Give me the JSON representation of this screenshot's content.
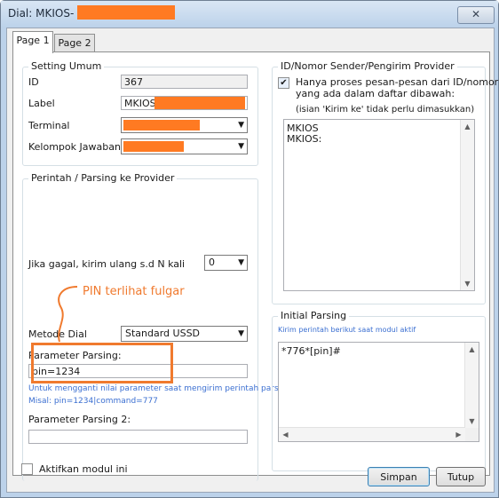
{
  "window": {
    "title": "Dial: MKIOS-",
    "close_glyph": "✕"
  },
  "tabs": [
    {
      "label": "Page 1",
      "active": true
    },
    {
      "label": "Page 2",
      "active": false
    }
  ],
  "setting_umum": {
    "legend": "Setting Umum",
    "id_label": "ID",
    "id_value": "367",
    "label_label": "Label",
    "label_value": "MKIOS-",
    "terminal_label": "Terminal",
    "kelompok_label": "Kelompok Jawaban"
  },
  "perintah": {
    "legend": "Perintah / Parsing ke Provider",
    "retry_label": "Jika gagal, kirim ulang s.d N kali",
    "retry_value": "0",
    "metode_label": "Metode Dial",
    "metode_value": "Standard USSD",
    "param_label": "Parameter Parsing:",
    "param_value": "pin=1234",
    "param_note1": "Untuk mengganti nilai parameter saat mengirim perintah parsing",
    "param_note2": "Misal: pin=1234|command=777",
    "param2_label": "Parameter Parsing 2:",
    "param2_value": ""
  },
  "provider": {
    "legend": "ID/Nomor Sender/Pengirim Provider",
    "only_label_line1": "Hanya proses pesan-pesan dari ID/nomor",
    "only_label_line2": "yang ada dalam daftar dibawah:",
    "only_checked": true,
    "hint": "(isian 'Kirim ke' tidak perlu dimasukkan)",
    "list": [
      "MKIOS",
      "MKIOS:"
    ]
  },
  "initial_parsing": {
    "legend": "Initial Parsing",
    "note": "Kirim perintah berikut saat modul aktif",
    "value": "*776*[pin]#"
  },
  "footer": {
    "aktifkan_label": "Aktifkan modul ini",
    "aktifkan_checked": false,
    "simpan_label": "Simpan",
    "tutup_label": "Tutup"
  },
  "annotation": {
    "text": "PIN terlihat fulgar"
  },
  "colors": {
    "accent_annotation": "#f07a2e",
    "redaction": "#ff7a22",
    "note_blue": "#3b6fd1"
  },
  "icons": {
    "check": "✔",
    "dropdown": "▼",
    "scroll_up": "▲",
    "scroll_down": "▼",
    "scroll_left": "◀",
    "scroll_right": "▶"
  }
}
